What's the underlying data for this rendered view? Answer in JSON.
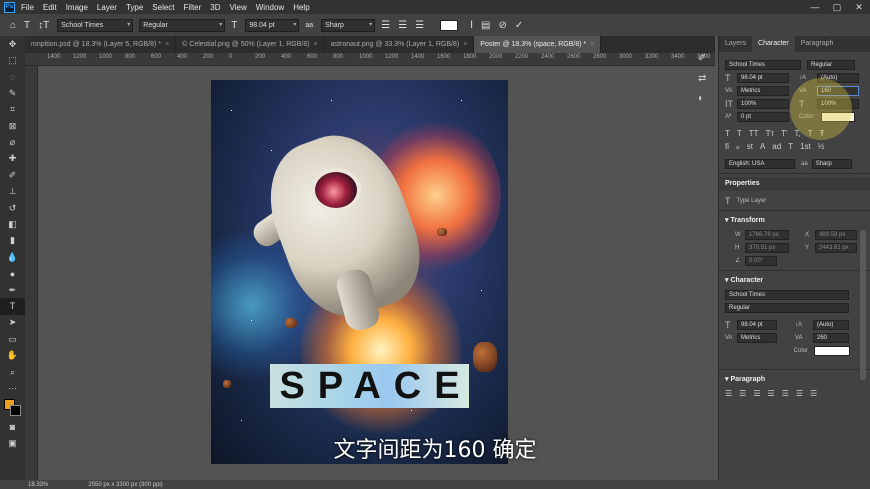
{
  "menubar": {
    "logo": "Ps",
    "items": [
      "File",
      "Edit",
      "Image",
      "Layer",
      "Type",
      "Select",
      "Filter",
      "3D",
      "View",
      "Window",
      "Help"
    ],
    "window_controls": [
      "—",
      "▢",
      "✕"
    ]
  },
  "options_bar": {
    "font_family": "School Times",
    "font_style": "Regular",
    "font_size": "98.04 pt",
    "anti_alias_label": "aa",
    "anti_alias": "Sharp"
  },
  "tabs": [
    {
      "label": "mnpition.psd @ 18.3% (Layer 5, RGB/8) *"
    },
    {
      "label": "© Celestial.png @ 50% (Layer 1, RGB/8)"
    },
    {
      "label": "astronaut.png @ 33.3% (Layer 1, RGB/8)"
    },
    {
      "label": "Poster @ 18.3% (space, RGB/8) *"
    }
  ],
  "ruler": {
    "ticks": [
      "1400",
      "1200",
      "1000",
      "800",
      "600",
      "400",
      "200",
      "0",
      "200",
      "400",
      "600",
      "800",
      "1000",
      "1200",
      "1400",
      "1600",
      "1800",
      "2000",
      "2200",
      "2400",
      "2600",
      "2800",
      "3000",
      "3200",
      "3400",
      "3600",
      "3800",
      "4000"
    ]
  },
  "canvas": {
    "text_layer": "SPACE",
    "subtitle": "文字间距为160  确定"
  },
  "status": {
    "zoom": "18.33%",
    "doc_size": "2550 px x 3300 px (300 ppi)"
  },
  "character_panel": {
    "tabs": [
      "Layers",
      "Character",
      "Paragraph"
    ],
    "active_tab": "Character",
    "font_family": "School Times",
    "font_style": "Regular",
    "font_size": "98.04 pt",
    "leading": "(Auto)",
    "kerning": "Metrics",
    "tracking": "160",
    "vertical_scale": "100%",
    "horizontal_scale": "100%",
    "baseline_shift": "0 pt",
    "color_label": "Color:",
    "style_glyphs": [
      "T",
      "T",
      "TT",
      "Tт",
      "T'",
      "T,",
      "T",
      "Ŧ"
    ],
    "opentype_glyphs": [
      "ﬁ",
      "ℴ",
      "st",
      "A",
      "ad",
      "T",
      "1st",
      "½"
    ],
    "language": "English: USA",
    "anti_alias": "Sharp",
    "color": "#f7f2e0"
  },
  "properties_panel": {
    "title": "Properties",
    "layer_type": "Type Layer",
    "transform": {
      "title": "Transform",
      "w": "1766.76 px",
      "x": "489.59 px",
      "h": "370.51 px",
      "y": "2443.61 px",
      "angle": "0.00°",
      "w_label": "W",
      "x_label": "X",
      "h_label": "H",
      "y_label": "Y"
    },
    "character": {
      "title": "Character",
      "font_family": "School Times",
      "font_style": "Regular",
      "font_size": "98.04 pt",
      "leading": "(Auto)",
      "kerning": "Metrics",
      "tracking": "260",
      "color_label": "Color"
    },
    "paragraph": {
      "title": "Paragraph"
    }
  }
}
